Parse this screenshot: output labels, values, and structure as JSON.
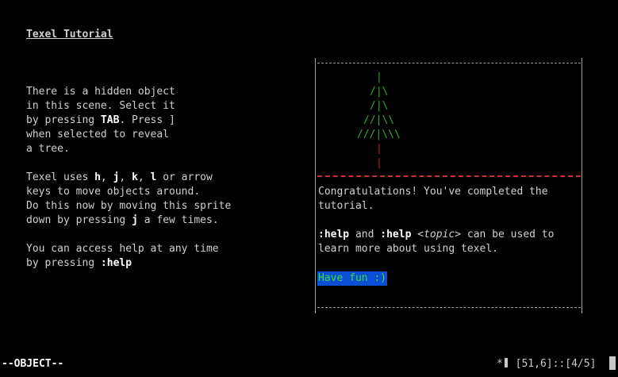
{
  "tutorial": {
    "title": "Texel Tutorial",
    "para1": [
      "There is a hidden object",
      "in this scene. Select it",
      "by pressing ",
      "TAB",
      ". Press ]",
      "when selected to reveal",
      "a tree."
    ],
    "para2": [
      "Texel uses ",
      "h",
      ", ",
      "j",
      ", ",
      "k",
      ", ",
      "l",
      " or arrow",
      "keys to move objects around.",
      "Do this now by moving this sprite",
      "down by pressing ",
      "j",
      " a few times."
    ],
    "para3": [
      "You can access help at any time",
      "by pressing ",
      ":help"
    ]
  },
  "tree": {
    "lines": [
      "|",
      "/|\\",
      "/|\\",
      "//|\\\\",
      "///|\\\\\\"
    ],
    "trunk": [
      "|",
      "|"
    ]
  },
  "message": {
    "congrats_1": "Congratulations! You've completed the",
    "congrats_2": "tutorial.",
    "help_cmd": ":help",
    "and": " and ",
    "help_topic_cmd": ":help ",
    "topic_lt": "<",
    "topic": "topic",
    "topic_gt": ">",
    "can_be_used": " can be used to",
    "learn_more": "learn more about using texel.",
    "have_fun": "Have fun :)"
  },
  "status": {
    "mode": "--OBJECT--",
    "position": "[51,6]::[4/5]",
    "asterisk": "*"
  },
  "colors": {
    "background": "#000000",
    "tree": "#2faa2f",
    "trunk": "#b02020",
    "separator": "#c83232",
    "highlight_bg": "#0a4fd6",
    "highlight_fg": "#3ddc3d"
  }
}
